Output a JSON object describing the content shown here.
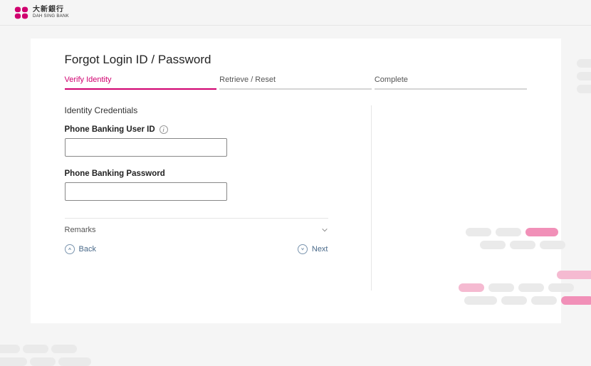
{
  "brand": {
    "name_zh": "大新銀行",
    "name_en": "DAH SING BANK"
  },
  "page": {
    "title": "Forgot Login ID / Password",
    "steps": [
      {
        "label": "Verify Identity",
        "active": true
      },
      {
        "label": "Retrieve / Reset",
        "active": false
      },
      {
        "label": "Complete",
        "active": false
      }
    ],
    "section_title": "Identity Credentials",
    "fields": {
      "phone_banking_user_id": {
        "label": "Phone Banking User ID",
        "value": ""
      },
      "phone_banking_password": {
        "label": "Phone Banking Password",
        "value": ""
      }
    },
    "remarks": {
      "label": "Remarks"
    },
    "nav": {
      "back": "Back",
      "next": "Next"
    }
  }
}
